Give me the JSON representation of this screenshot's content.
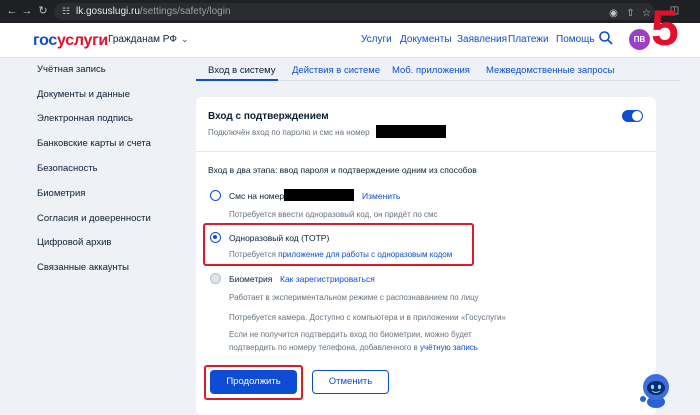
{
  "browser": {
    "url_host": "lk.gosuslugi.ru",
    "url_path": "/settings/safety/login"
  },
  "header": {
    "logo_part1": "гос",
    "logo_part2": "услуги",
    "persona_label": "Гражданам РФ",
    "nav": [
      "Услуги",
      "Документы",
      "Заявления",
      "Платежи",
      "Помощь"
    ],
    "avatar_initials": "ПВ",
    "overlay_number": "5"
  },
  "sidebar": {
    "items": [
      "Учётная запись",
      "Документы и данные",
      "Электронная подпись",
      "Банковские карты и счета",
      "Безопасность",
      "Биометрия",
      "Согласия и доверенности",
      "Цифровой архив",
      "Связанные аккаунты"
    ]
  },
  "tabs": [
    "Вход в систему",
    "Действия в системе",
    "Моб. приложения",
    "Межведомственные запросы"
  ],
  "card": {
    "title": "Вход с подтверждением",
    "subtitle": "Подключён вход по паролю и смс на номер",
    "two_step_label": "Вход в два этапа: ввод пароля и подтверждение одним из способов",
    "options": {
      "sms": {
        "label": "Смс на номер",
        "change_link": "Изменить",
        "hint": "Потребуется ввести одноразовый код, он придёт по смс"
      },
      "totp": {
        "label": "Одноразовый код (TOTP)",
        "hint_prefix": "Потребуется",
        "hint_link": "приложение для работы с одноразовым кодом"
      },
      "biometry": {
        "label": "Биометрия",
        "register_link": "Как зарегистрироваться",
        "hint1": "Работает в экспериментальном режиме с распознаванием по лицу",
        "hint2": "Потребуется камера. Доступно с компьютера и в приложении «Госуслуги»",
        "hint3_line1": "Если не получится подтвердить вход по биометрии, можно будет",
        "hint3_line2_prefix": "подтвердить по номеру телефона, добавленного в",
        "hint3_link": "учётную запись"
      }
    },
    "buttons": {
      "continue": "Продолжить",
      "cancel": "Отменить"
    }
  },
  "colors": {
    "accent": "#0d4cd3",
    "brand_red": "#e3102d",
    "highlight_box": "#d71c2c",
    "page_bg": "#eef2f7"
  }
}
